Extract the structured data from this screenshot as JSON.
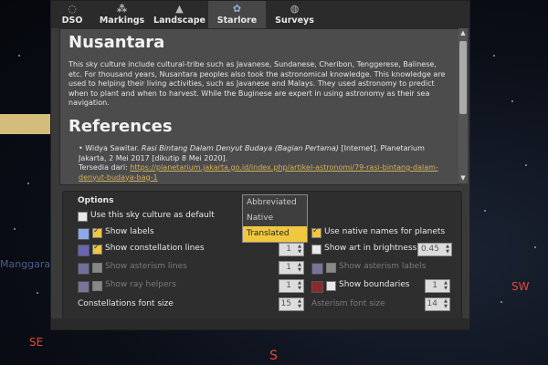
{
  "sky": {
    "compass": {
      "se": "SE",
      "s": "S",
      "sw": "SW"
    },
    "faint_labels": [
      "Manggarai"
    ]
  },
  "tabs": [
    {
      "label": "DSO",
      "icon": "dso-icon"
    },
    {
      "label": "Markings",
      "icon": "markings-icon"
    },
    {
      "label": "Landscape",
      "icon": "landscape-icon"
    },
    {
      "label": "Starlore",
      "icon": "starlore-icon",
      "active": true
    },
    {
      "label": "Surveys",
      "icon": "surveys-icon"
    }
  ],
  "doc": {
    "heading": "Nusantara",
    "para": "This sky culture include cultural-tribe such as Javanese, Sundanese, Cheribon, Tenggerese, Balinese, etc. For thousand years, Nusantara peoples also took the astronomical knowledge. This knowledge are used to helping their living activities, such as Javanese and Malays. They used astronomy to predict when to plant and when to harvest. While the Buginese are expert in using astronomy as their sea navigation.",
    "ref_heading": "References",
    "ref_author": "Widya Sawitar. ",
    "ref_title": "Rasi Bintang Dalam Denyut Budaya (Bagian Pertama)",
    "ref_rest": " [Internet]. Planetarium Jakarta, 2 Mei 2017 [dikutip 8 Mei 2020].",
    "ref_avail": "Tersedia dari: ",
    "ref_link": "https://planetarium.jakarta.go.id/index.php/artikel-astronomi/79-rasi-bintang-dalam-denyut-budaya-bag-1"
  },
  "options": {
    "title": "Options",
    "use_default": "Use this sky culture as default",
    "show_labels": "Show labels",
    "native_names": "Use native names for planets",
    "constellation_lines": "Show constellation lines",
    "art_brightness": "Show art in brightness",
    "asterism_lines": "Show asterism lines",
    "asterism_labels": "Show asterism labels",
    "ray_helpers": "Show ray helpers",
    "boundaries": "Show boundaries",
    "const_font": "Constellations font size",
    "ast_font": "Asterism font size",
    "values": {
      "constellation_lines": "1",
      "art_brightness": "0.45",
      "asterism_lines": "1",
      "ray_helpers": "1",
      "boundaries": "1",
      "const_font": "15",
      "ast_font": "14"
    },
    "colors": {
      "labels": "#8fa8e8",
      "constellation_lines": "#6a64b4",
      "asterism_lines": "#8c8cc8",
      "asterism_labels": "#9a94c8",
      "ray_helpers": "#9a94c8",
      "boundaries": "#8c2a2a"
    }
  },
  "dropdown": {
    "options": [
      "Abbreviated",
      "Native",
      "Translated"
    ],
    "selected": "Translated"
  }
}
